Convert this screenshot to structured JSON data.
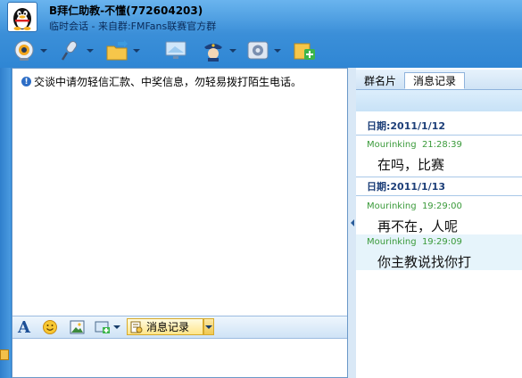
{
  "header": {
    "title": "B拜仁助教-不懂(772604203)",
    "subtitle": "临时会话 - 来自群:FMFans联赛官方群"
  },
  "toolbar": {
    "buttons": [
      {
        "icon": "webcam-icon",
        "has_dropdown": true
      },
      {
        "icon": "microphone-icon",
        "has_dropdown": true
      },
      {
        "icon": "folder-transfer-icon",
        "has_dropdown": true
      },
      {
        "icon": "monitor-icon",
        "has_dropdown": false
      },
      {
        "icon": "police-icon",
        "has_dropdown": true
      },
      {
        "icon": "settings-icon",
        "has_dropdown": true
      },
      {
        "icon": "add-icon",
        "has_dropdown": false
      }
    ]
  },
  "chat": {
    "notice": "交谈中请勿轻信汇款、中奖信息，勿轻易拨打陌生电话。"
  },
  "input_toolbar": {
    "history_label": "消息记录"
  },
  "right_panel": {
    "tabs": [
      "群名片",
      "消息记录"
    ],
    "active_tab": "消息记录",
    "history": [
      {
        "date": "日期:2011/1/12"
      },
      {
        "sender": "Mourinking",
        "time": "21:28:39",
        "text": "在吗，比赛"
      },
      {
        "date": "日期:2011/1/13"
      },
      {
        "sender": "Mourinking",
        "time": "19:29:00",
        "text": "再不在，人呢"
      },
      {
        "sender": "Mourinking",
        "time": "19:29:09",
        "text": "你主教说找你打"
      }
    ]
  },
  "colors": {
    "title_bar": "#3b8fd8",
    "sender_green": "#3a9a3a",
    "date_blue": "#1c3e78"
  }
}
